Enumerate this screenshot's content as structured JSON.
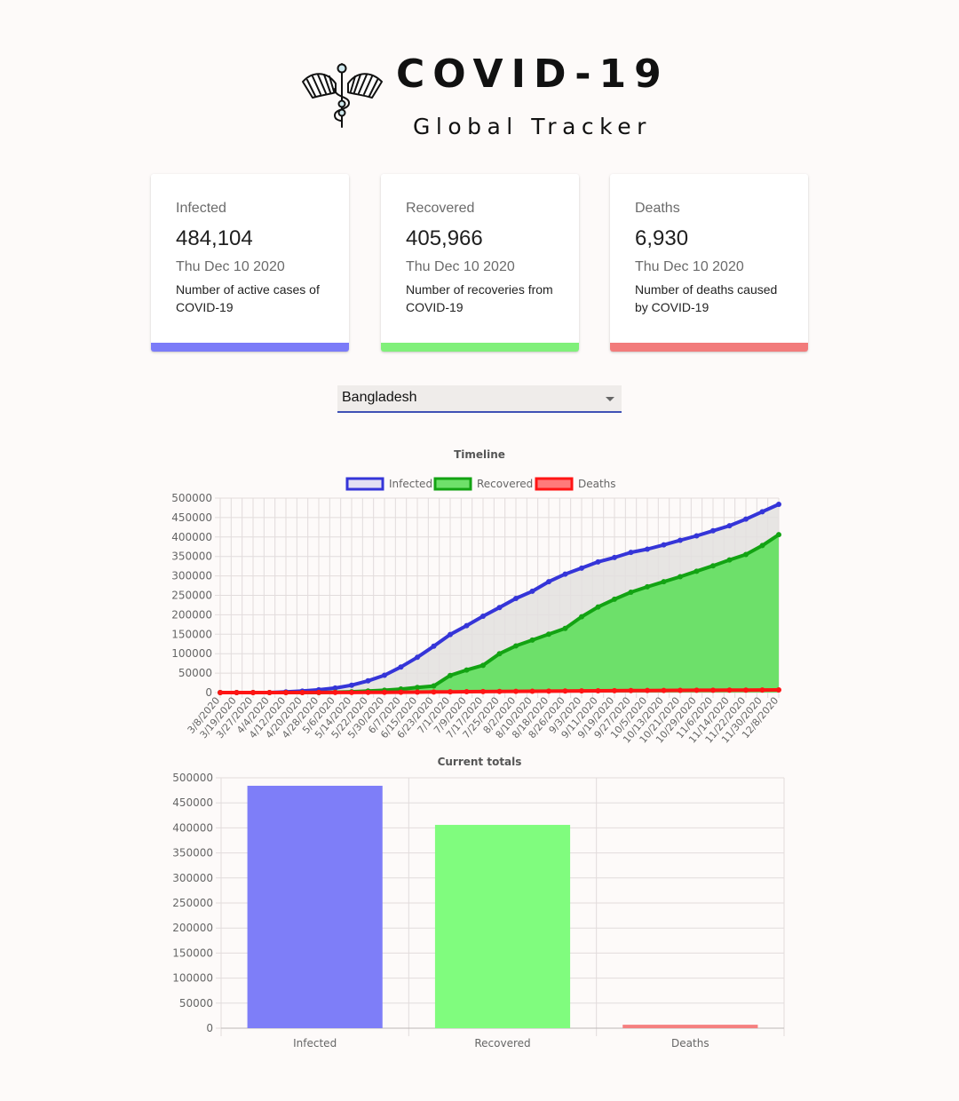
{
  "header": {
    "title": "COVID-19",
    "subtitle": "Global Tracker",
    "logo_icon": "caduceus-icon"
  },
  "cards": [
    {
      "label": "Infected",
      "value": "484,104",
      "date": "Thu Dec 10 2020",
      "description": "Number of active cases of COVID-19",
      "color": "#7b7bf8"
    },
    {
      "label": "Recovered",
      "value": "405,966",
      "date": "Thu Dec 10 2020",
      "description": "Number of recoveries from COVID-19",
      "color": "#80f07a"
    },
    {
      "label": "Deaths",
      "value": "6,930",
      "date": "Thu Dec 10 2020",
      "description": "Number of deaths caused by COVID-19",
      "color": "#f27b7b"
    }
  ],
  "country_select": {
    "selected": "Bangladesh",
    "icon": "caret-down-icon"
  },
  "colors": {
    "infected_line": "#3535d8",
    "recovered_line": "#13a313",
    "deaths_line": "#ff1414",
    "recovered_fill": "#6de06a",
    "infected_fill": "#e3e0df",
    "bar_infected": "#7e7ef8",
    "bar_recovered": "#80fc7e",
    "bar_deaths": "#f58080",
    "grid": "#e2dcdc",
    "text": "#666666",
    "title_text": "#555555"
  },
  "chart_data": [
    {
      "type": "line",
      "title": "Timeline",
      "x_labels": [
        "3/8/2020",
        "3/19/2020",
        "3/27/2020",
        "4/4/2020",
        "4/12/2020",
        "4/20/2020",
        "4/28/2020",
        "5/6/2020",
        "5/14/2020",
        "5/22/2020",
        "5/30/2020",
        "6/7/2020",
        "6/15/2020",
        "6/23/2020",
        "7/1/2020",
        "7/9/2020",
        "7/17/2020",
        "7/25/2020",
        "8/2/2020",
        "8/10/2020",
        "8/18/2020",
        "8/26/2020",
        "9/3/2020",
        "9/11/2020",
        "9/19/2020",
        "9/27/2020",
        "10/5/2020",
        "10/13/2020",
        "10/21/2020",
        "10/29/2020",
        "11/6/2020",
        "11/14/2020",
        "11/22/2020",
        "11/30/2020",
        "12/8/2020"
      ],
      "ylim": [
        0,
        500000
      ],
      "yticks": [
        0,
        50000,
        100000,
        150000,
        200000,
        250000,
        300000,
        350000,
        400000,
        450000,
        500000
      ],
      "legend_position": "top",
      "grid": true,
      "series": [
        {
          "name": "Infected",
          "values": [
            3,
            20,
            48,
            88,
            1838,
            3772,
            7103,
            11719,
            18863,
            30205,
            44608,
            65769,
            90619,
            119198,
            149258,
            172134,
            196323,
            218658,
            242102,
            260507,
            285091,
            304583,
            320041,
            336044,
            347372,
            360555,
            368690,
            379738,
            391586,
            402988,
            416006,
            428965,
            446000,
            465000,
            484104
          ]
        },
        {
          "name": "Recovered",
          "values": [
            0,
            0,
            0,
            0,
            0,
            0,
            0,
            1000,
            2000,
            4000,
            6000,
            9000,
            13000,
            17000,
            44000,
            58000,
            70000,
            100000,
            120000,
            135000,
            150000,
            165000,
            195000,
            220000,
            240000,
            258000,
            272000,
            285000,
            298000,
            312000,
            326000,
            341000,
            355000,
            378000,
            405966
          ]
        },
        {
          "name": "Deaths",
          "values": [
            0,
            0,
            0,
            0,
            60,
            120,
            190,
            260,
            330,
            420,
            600,
            880,
            1200,
            1510,
            1930,
            2240,
            2550,
            2870,
            3180,
            3430,
            3750,
            4030,
            4350,
            4650,
            4860,
            5100,
            5350,
            5530,
            5690,
            5910,
            6010,
            6220,
            6370,
            6580,
            6930
          ]
        }
      ]
    },
    {
      "type": "bar",
      "title": "Current totals",
      "categories": [
        "Infected",
        "Recovered",
        "Deaths"
      ],
      "values": [
        484104,
        405966,
        6930
      ],
      "ylim": [
        0,
        500000
      ],
      "yticks": [
        0,
        50000,
        100000,
        150000,
        200000,
        250000,
        300000,
        350000,
        400000,
        450000,
        500000
      ],
      "grid": true
    }
  ]
}
